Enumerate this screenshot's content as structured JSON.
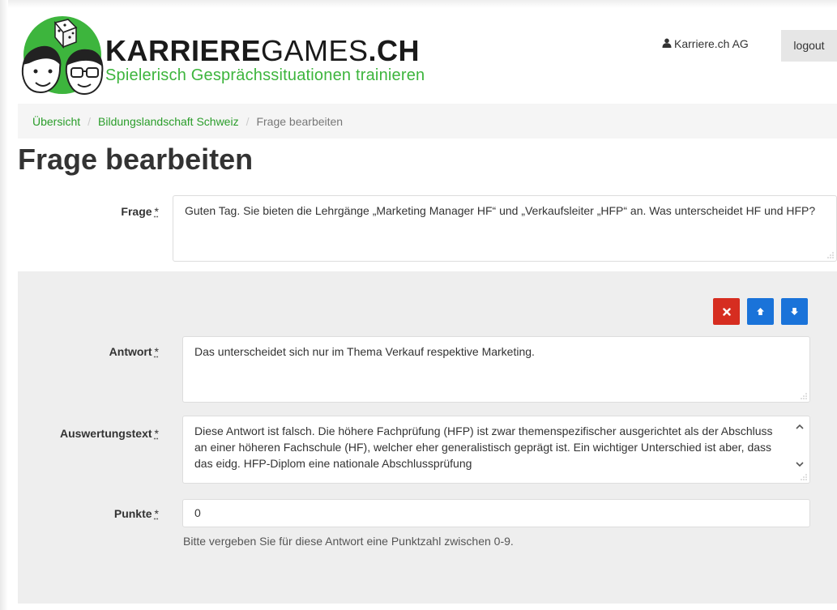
{
  "header": {
    "brand_bold": "KARRIERE",
    "brand_light": "GAMES",
    "brand_tld": ".CH",
    "tagline": "Spielerisch Gesprächssituationen trainieren",
    "user_name": "Karriere.ch AG",
    "logout_label": "logout"
  },
  "breadcrumb": {
    "items": [
      "Übersicht",
      "Bildungslandschaft Schweiz"
    ],
    "active": "Frage bearbeiten",
    "separator": "/"
  },
  "page_title": "Frage bearbeiten",
  "form": {
    "frage": {
      "label": "Frage",
      "required_mark": "*",
      "value": "Guten Tag. Sie bieten die Lehrgänge „Marketing Manager HF“ und „Verkaufsleiter „HFP“ an. Was unterscheidet HF und HFP?"
    },
    "antwort": {
      "label": "Antwort",
      "required_mark": "*",
      "value": "Das unterscheidet sich nur im Thema Verkauf respektive Marketing."
    },
    "auswertung": {
      "label": "Auswertungstext",
      "required_mark": "*",
      "value": "Diese Antwort ist falsch. Die höhere Fachprüfung (HFP) ist zwar themenspezifischer ausgerichtet als der Abschluss an einer höheren Fachschule (HF), welcher eher generalistisch geprägt ist. Ein wichtiger Unterschied ist aber, dass das eidg. HFP-Diplom eine nationale Abschlussprüfung"
    },
    "punkte": {
      "label": "Punkte",
      "required_mark": "*",
      "value": "0",
      "help": "Bitte vergeben Sie für diese Antwort eine Punktzahl zwischen 0-9."
    }
  },
  "colors": {
    "brand_green": "#3db53d",
    "link_green": "#2a9d2a",
    "delete_red": "#d62d20",
    "move_blue": "#1a73d9"
  },
  "icons": [
    "user-icon",
    "delete-icon",
    "arrow-up-icon",
    "arrow-down-icon",
    "resize-grip-icon"
  ]
}
